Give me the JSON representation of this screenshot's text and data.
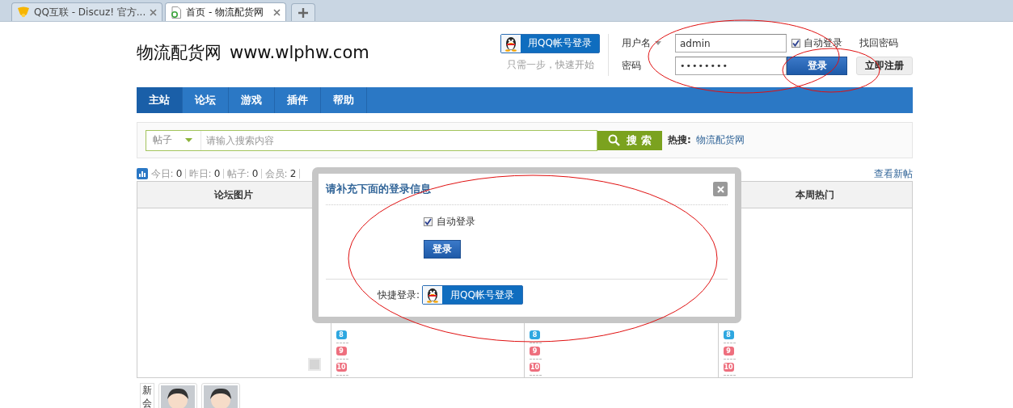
{
  "browser_tabs": [
    {
      "title": "QQ互联 - Discuz! 官方...",
      "kind": "qq",
      "selected": false
    },
    {
      "title": "首页 - 物流配货网",
      "kind": "page",
      "selected": true
    }
  ],
  "header": {
    "site_name": "物流配货网",
    "site_url": "www.wlphw.com",
    "qq_login": {
      "label": "用QQ帐号登录",
      "hint": "只需一步，快速开始"
    },
    "login": {
      "username_label": "用户名",
      "username": "admin",
      "password_label": "密码",
      "password": "••••••••",
      "auto_login": {
        "label": "自动登录",
        "checked": true
      },
      "forgot": "找回密码",
      "login_button": "登录",
      "register_button": "立即注册"
    }
  },
  "nav": [
    {
      "label": "主站",
      "selected": true
    },
    {
      "label": "论坛",
      "selected": false
    },
    {
      "label": "游戏",
      "selected": false
    },
    {
      "label": "插件",
      "selected": false
    },
    {
      "label": "帮助",
      "selected": false
    }
  ],
  "search": {
    "scope": "帖子",
    "placeholder": "请输入搜索内容",
    "button": "搜 索",
    "hot_label": "热搜:",
    "hot_links": [
      "物流配货网"
    ]
  },
  "stats": {
    "items": [
      {
        "label": "今日:",
        "value": "0"
      },
      {
        "label": "昨日:",
        "value": "0"
      },
      {
        "label": "帖子:",
        "value": "0"
      },
      {
        "label": "会员:",
        "value": "2"
      }
    ],
    "view_new": "查看新帖"
  },
  "table": {
    "columns": [
      {
        "kind": "slider",
        "title": "论坛图片"
      },
      {
        "kind": "ranked",
        "ranks": [
          {
            "label": "8",
            "color": "#2ea7e0"
          },
          {
            "label": "9",
            "color": "#ee6f7e"
          },
          {
            "label": "10",
            "color": "#ee6f7e"
          }
        ]
      },
      {
        "kind": "ranked",
        "ranks": [
          {
            "label": "8",
            "color": "#2ea7e0"
          },
          {
            "label": "9",
            "color": "#ee6f7e"
          },
          {
            "label": "10",
            "color": "#ee6f7e"
          }
        ]
      },
      {
        "kind": "ranked",
        "title": "本周热门",
        "ranks": [
          {
            "label": "8",
            "color": "#2ea7e0"
          },
          {
            "label": "9",
            "color": "#ee6f7e"
          },
          {
            "label": "10",
            "color": "#ee6f7e"
          }
        ]
      }
    ]
  },
  "new_members": {
    "label": "新会",
    "members": [
      {
        "kind": "avatar"
      },
      {
        "kind": "avatar"
      }
    ]
  },
  "dialog": {
    "title": "请补充下面的登录信息",
    "auto_login": {
      "label": "自动登录",
      "checked": true
    },
    "login_button": "登录",
    "quick_label": "快捷登录:",
    "qq_button": "用QQ帐号登录"
  },
  "annotations": [
    {
      "kind": "ellipse"
    },
    {
      "kind": "ellipse"
    },
    {
      "kind": "ellipse"
    }
  ]
}
